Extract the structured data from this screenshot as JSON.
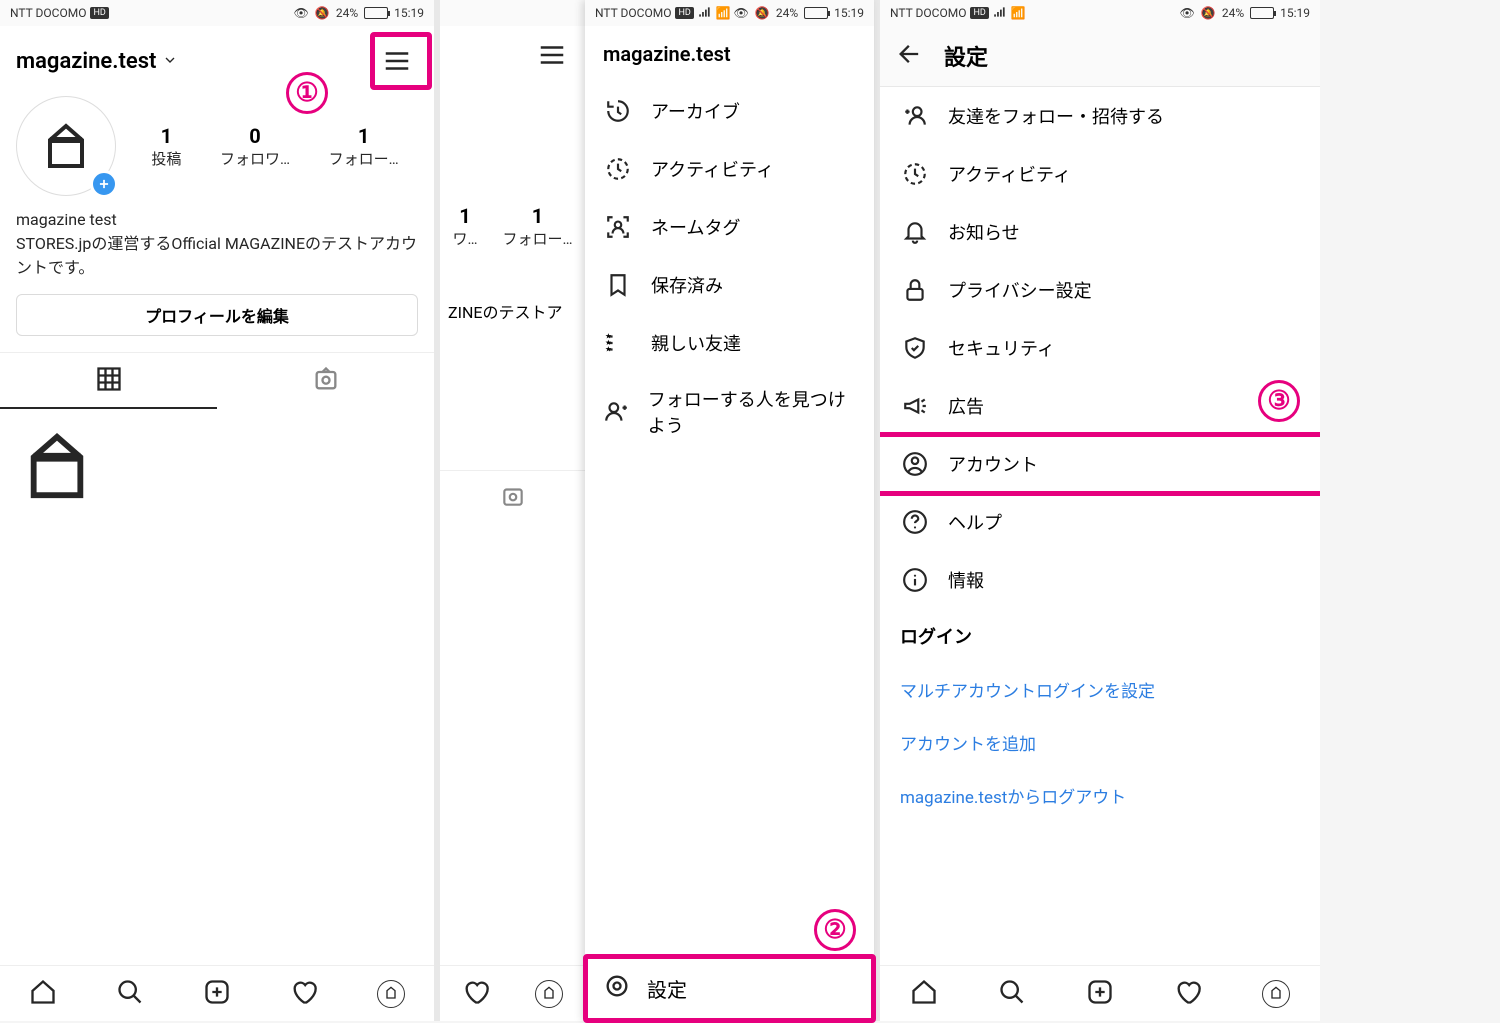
{
  "colors": {
    "accent": "#e6007e",
    "link": "#2b7de1"
  },
  "status": {
    "carrier": "NTT DOCOMO",
    "hd": "HD",
    "battery_pct": "24%",
    "time": "15:19"
  },
  "profile": {
    "username": "magazine.test",
    "display_name": "magazine test",
    "bio": "STORES.jpの運営するOfficial MAGAZINEのテストアカウントです。",
    "edit_label": "プロフィールを編集",
    "stats": {
      "posts_num": "1",
      "posts_label": "投稿",
      "followers_num": "0",
      "followers_label": "フォロワ…",
      "following_num": "1",
      "following_label": "フォロー…"
    }
  },
  "sliver": {
    "stat1_num": "1",
    "stat1_label": "ワ…",
    "stat2_num": "1",
    "stat2_label": "フォロー…",
    "bio_frag": "ZINEのテストア"
  },
  "drawer": {
    "title": "magazine.test",
    "items": [
      {
        "icon": "archive-icon",
        "label": "アーカイブ"
      },
      {
        "icon": "activity-icon",
        "label": "アクティビティ"
      },
      {
        "icon": "nametag-icon",
        "label": "ネームタグ"
      },
      {
        "icon": "bookmark-icon",
        "label": "保存済み"
      },
      {
        "icon": "close-friends-icon",
        "label": "親しい友達"
      },
      {
        "icon": "discover-icon",
        "label": "フォローする人を見つけよう"
      }
    ],
    "settings": {
      "icon": "cog-icon",
      "label": "設定"
    }
  },
  "settings_screen": {
    "title": "設定",
    "items": [
      {
        "icon": "follow-invite-icon",
        "label": "友達をフォロー・招待する"
      },
      {
        "icon": "activity-icon",
        "label": "アクティビティ"
      },
      {
        "icon": "bell-icon",
        "label": "お知らせ"
      },
      {
        "icon": "lock-icon",
        "label": "プライバシー設定"
      },
      {
        "icon": "shield-icon",
        "label": "セキュリティ"
      },
      {
        "icon": "megaphone-icon",
        "label": "広告"
      },
      {
        "icon": "user-circle-icon",
        "label": "アカウント"
      },
      {
        "icon": "help-icon",
        "label": "ヘルプ"
      },
      {
        "icon": "info-icon",
        "label": "情報"
      }
    ],
    "login_section": "ログイン",
    "links": [
      "マルチアカウントログインを設定",
      "アカウントを追加",
      "magazine.testからログアウト"
    ]
  },
  "callouts": {
    "c1": "①",
    "c2": "②",
    "c3": "③"
  }
}
